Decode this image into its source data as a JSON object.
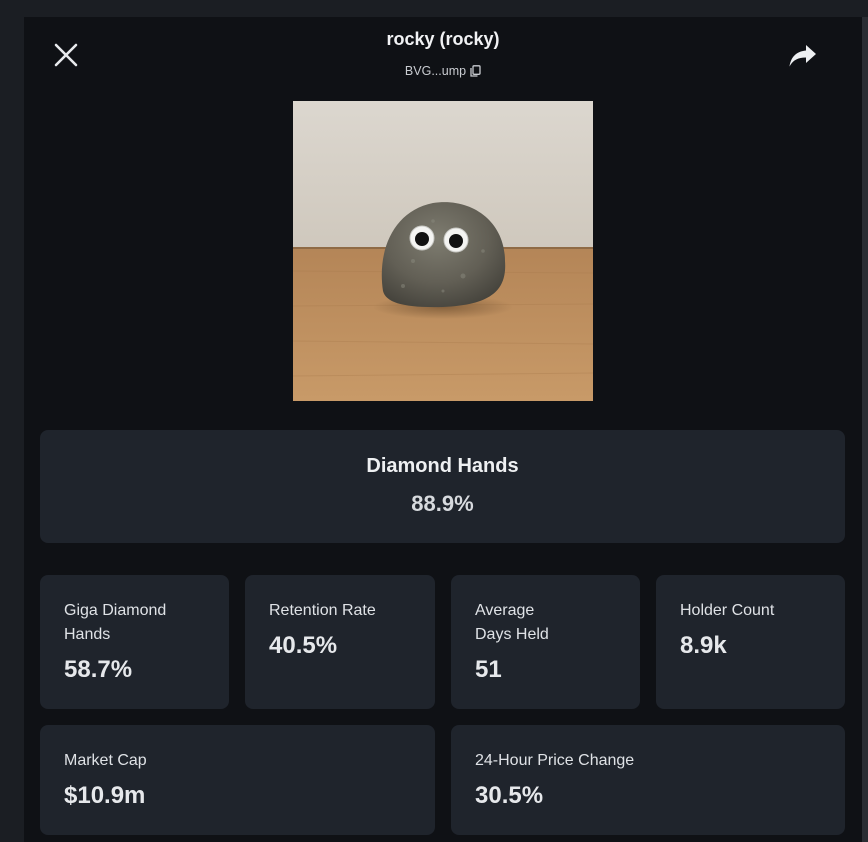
{
  "header": {
    "title": "rocky (rocky)",
    "address": "BVG...ump"
  },
  "icons": {
    "close": "close-icon",
    "share": "share-icon",
    "copy": "copy-icon"
  },
  "image": {
    "alt": "rocky"
  },
  "hero": {
    "label": "Diamond Hands",
    "value": "88.9%"
  },
  "stats": [
    {
      "label": "Giga Diamond Hands",
      "value": "58.7%"
    },
    {
      "label": "Retention Rate",
      "value": "40.5%"
    },
    {
      "label": "Average Days Held",
      "value": "51"
    },
    {
      "label": "Holder Count",
      "value": "8.9k"
    },
    {
      "label": "Market Cap",
      "value": "$10.9m"
    },
    {
      "label": "24-Hour Price Change",
      "value": "30.5%"
    }
  ],
  "colors": {
    "background": "#1b1e23",
    "panel": "#0f1115",
    "card": "#1f242c",
    "text": "#e9ebee"
  }
}
